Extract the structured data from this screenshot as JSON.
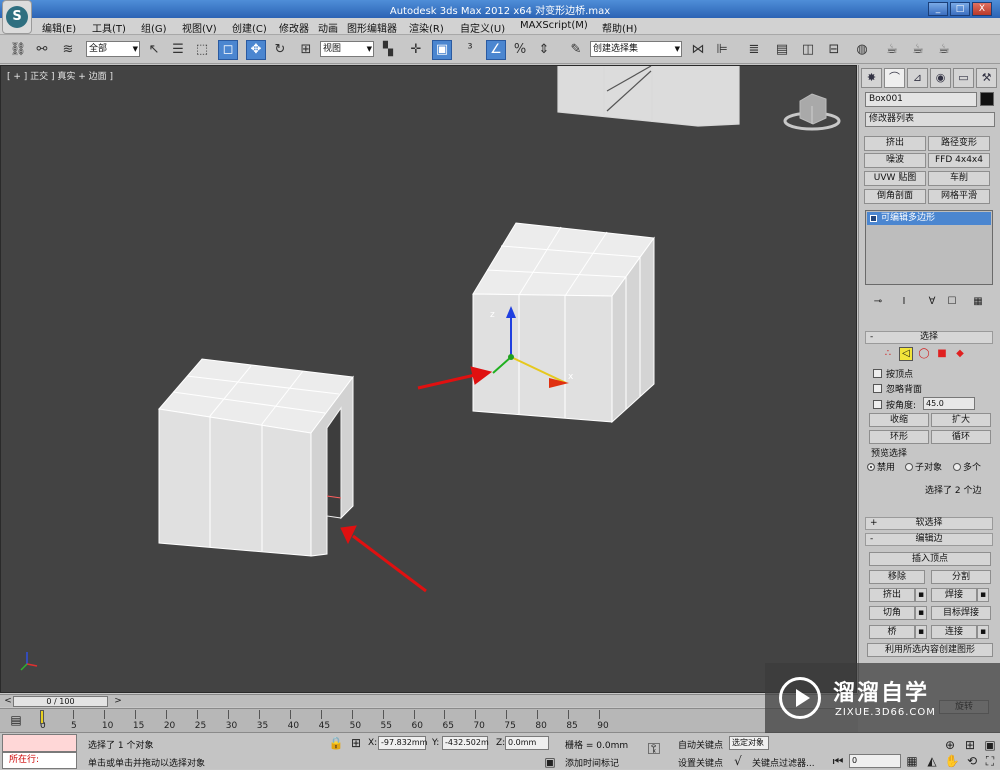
{
  "window": {
    "title": "Autodesk 3ds Max  2012 x64    对变形边桥.max",
    "minimize": "_",
    "maximize": "□",
    "close": "X"
  },
  "menu": [
    "编辑(E)",
    "工具(T)",
    "组(G)",
    "视图(V)",
    "创建(C)",
    "修改器",
    "动画",
    "图形编辑器",
    "渲染(R)",
    "自定义(U)",
    "MAXScript(M)",
    "帮助(H)"
  ],
  "toolbar": {
    "selection_filter": "全部",
    "reference_coord": "视图",
    "named_selection": "创建选择集"
  },
  "viewport": {
    "label": "[ + ] 正交 ] 真实 + 边面 ]"
  },
  "command_panel": {
    "object_name": "Box001",
    "modifier_list": "修改器列表",
    "modifier_buttons": [
      "挤出",
      "路径变形",
      "噪波",
      "FFD 4x4x4",
      "UVW 贴图",
      "车削",
      "倒角剖面",
      "网格平滑"
    ],
    "stack_item": "可编辑多边形",
    "selection_rollout": {
      "title": "选择",
      "by_vertex": "按顶点",
      "ignore_backfacing": "忽略背面",
      "by_angle": "按角度:",
      "angle_value": "45.0",
      "shrink": "收缩",
      "grow": "扩大",
      "ring": "环形",
      "loop": "循环",
      "preview_title": "预览选择",
      "preview_off": "禁用",
      "preview_subobj": "子对象",
      "preview_multi": "多个",
      "status": "选择了 2 个边"
    },
    "soft_selection_title": "软选择",
    "edit_edges": {
      "title": "编辑边",
      "insert_vertex": "插入顶点",
      "remove": "移除",
      "split": "分割",
      "extrude": "挤出",
      "weld": "焊接",
      "chamfer": "切角",
      "target_weld": "目标焊接",
      "bridge": "桥",
      "connect": "连接",
      "create_shape": "利用所选内容创建图形",
      "rotate": "旋转"
    }
  },
  "timeline": {
    "frame_display": "0 / 100",
    "ticks": [
      "0",
      "5",
      "10",
      "15",
      "20",
      "25",
      "30",
      "35",
      "40",
      "45",
      "50",
      "55",
      "60",
      "65",
      "70",
      "75",
      "80",
      "85",
      "90"
    ]
  },
  "status": {
    "maxscript_label": "所在行:",
    "prompt_top": "选择了 1 个对象",
    "prompt_bottom": "单击或单击并拖动以选择对象",
    "x_label": "X:",
    "x_value": "-97.832mm",
    "y_label": "Y:",
    "y_value": "-432.502m",
    "z_label": "Z:",
    "z_value": "0.0mm",
    "grid": "栅格 = 0.0mm",
    "add_time_tag": "添加时间标记",
    "auto_key": "自动关键点",
    "selected_field": "选定对象",
    "set_key": "设置关键点",
    "key_filters": "关键点过滤器...",
    "frame_value": "0"
  },
  "watermark": {
    "title": "溜溜自学",
    "url": "ZIXUE.3D66.COM"
  },
  "colors": {
    "viewport_bg": "#434343",
    "accent_blue": "#4b86d0",
    "annotation_red": "#e01010"
  }
}
